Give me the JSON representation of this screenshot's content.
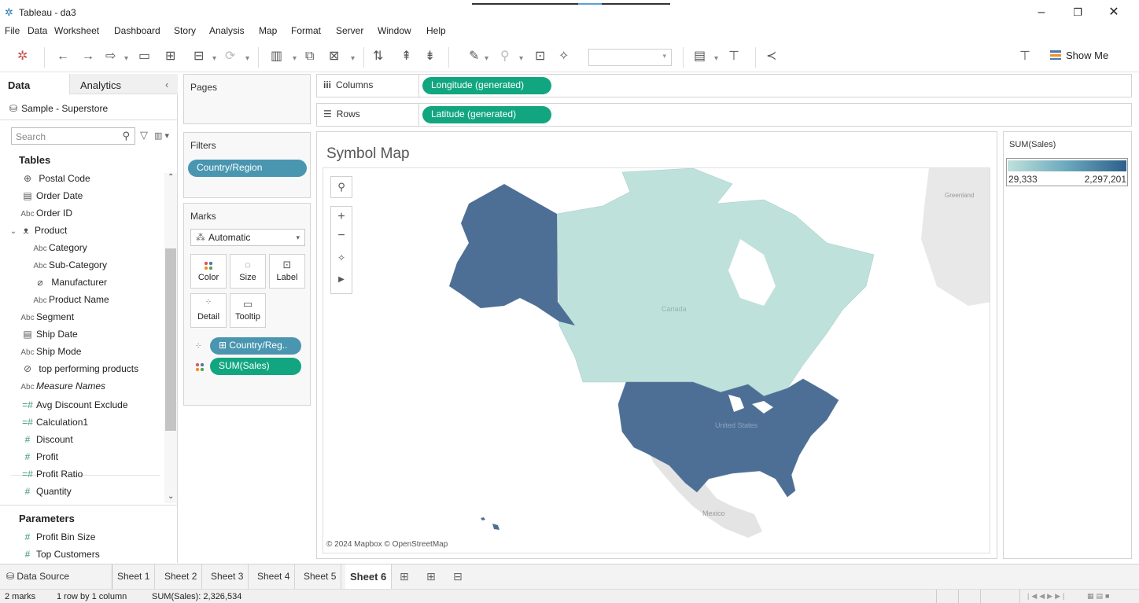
{
  "window": {
    "title": "Tableau - da3"
  },
  "menu": [
    "File",
    "Data",
    "Worksheet",
    "Dashboard",
    "Story",
    "Analysis",
    "Map",
    "Format",
    "Server",
    "Window",
    "Help"
  ],
  "toolbar": {
    "show_me": "Show Me",
    "mark_size_select": ""
  },
  "data_pane": {
    "tab_data": "Data",
    "tab_analytics": "Analytics",
    "data_source": "Sample - Superstore",
    "search_placeholder": "Search",
    "tables_header": "Tables",
    "fields": [
      {
        "name": "Postal Code",
        "type": "geo",
        "indent": 1
      },
      {
        "name": "Order Date",
        "type": "date",
        "indent": 0
      },
      {
        "name": "Order ID",
        "type": "abc",
        "indent": 0
      },
      {
        "name": "Product",
        "type": "hierarchy",
        "indent": 0
      },
      {
        "name": "Category",
        "type": "abc",
        "indent": 1
      },
      {
        "name": "Sub-Category",
        "type": "abc",
        "indent": 1
      },
      {
        "name": "Manufacturer",
        "type": "group",
        "indent": 1
      },
      {
        "name": "Product Name",
        "type": "abc",
        "indent": 1
      },
      {
        "name": "Segment",
        "type": "abc",
        "indent": 0
      },
      {
        "name": "Ship Date",
        "type": "date",
        "indent": 0
      },
      {
        "name": "Ship Mode",
        "type": "abc",
        "indent": 0
      },
      {
        "name": "top performing products",
        "type": "set",
        "indent": 0
      },
      {
        "name": "Measure Names",
        "type": "abc",
        "indent": 0,
        "italic": true
      },
      {
        "name": "Avg Discount Exclude",
        "type": "calc",
        "indent": 0
      },
      {
        "name": "Calculation1",
        "type": "calc",
        "indent": 0
      },
      {
        "name": "Discount",
        "type": "measure",
        "indent": 0
      },
      {
        "name": "Profit",
        "type": "measure",
        "indent": 0
      },
      {
        "name": "Profit Ratio",
        "type": "calc",
        "indent": 0
      },
      {
        "name": "Quantity",
        "type": "measure",
        "indent": 0
      }
    ],
    "parameters_header": "Parameters",
    "parameters": [
      {
        "name": "Profit Bin Size"
      },
      {
        "name": "Top Customers"
      }
    ]
  },
  "cards": {
    "pages_title": "Pages",
    "filters_title": "Filters",
    "filter_pill": "Country/Region",
    "marks_title": "Marks",
    "mark_type": "Automatic",
    "mark_buttons": {
      "color": "Color",
      "size": "Size",
      "label": "Label",
      "detail": "Detail",
      "tooltip": "Tooltip"
    },
    "mark_pills": {
      "detail": "Country/Reg..",
      "color": "SUM(Sales)"
    }
  },
  "shelves": {
    "columns_label": "Columns",
    "columns_pill": "Longitude (generated)",
    "rows_label": "Rows",
    "rows_pill": "Latitude (generated)"
  },
  "view": {
    "title": "Symbol Map",
    "map_labels": {
      "greenland": "Greenland",
      "canada": "Canada",
      "us": "United States",
      "mexico": "Mexico"
    },
    "attribution": "© 2024 Mapbox © OpenStreetMap"
  },
  "legend": {
    "title": "SUM(Sales)",
    "min": "29,333",
    "max": "2,297,201"
  },
  "colors": {
    "us_fill": "#4e6f95",
    "canada_fill": "#bfe1db",
    "pill_green": "#12a680",
    "pill_blue": "#4a96b0"
  },
  "sheets": {
    "data_source": "Data Source",
    "tabs": [
      "Sheet 1",
      "Sheet 2",
      "Sheet 3",
      "Sheet 4",
      "Sheet 5",
      "Sheet 6"
    ],
    "active": "Sheet 6"
  },
  "status": {
    "marks": "2 marks",
    "layout": "1 row by 1 column",
    "sum": "SUM(Sales): 2,326,534"
  }
}
